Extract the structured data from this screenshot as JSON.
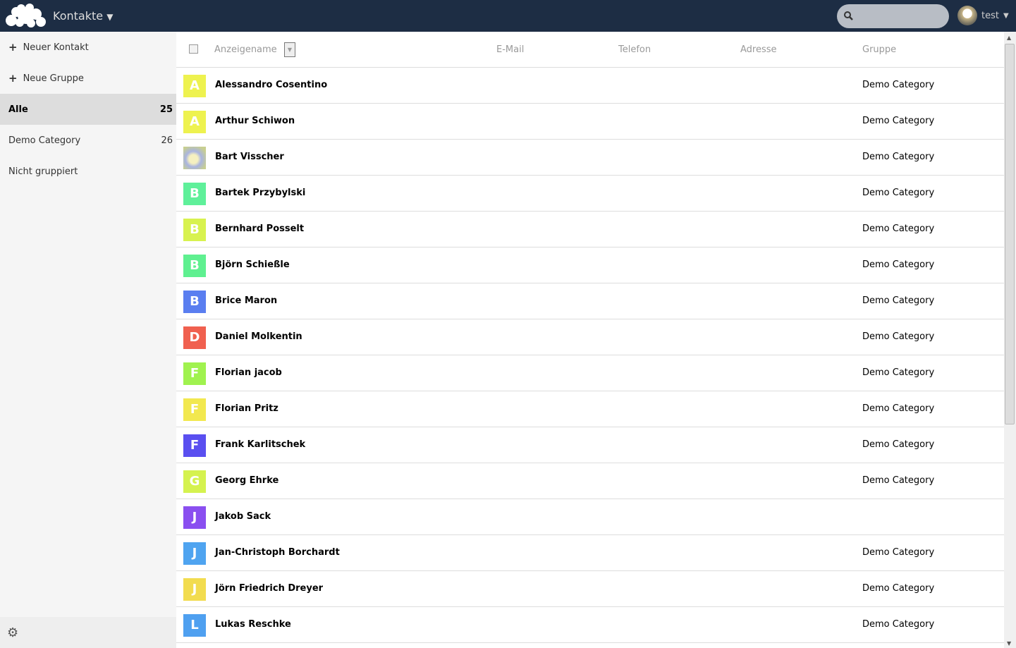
{
  "header": {
    "app_title": "Kontakte",
    "user": "test",
    "search_placeholder": ""
  },
  "sidebar": {
    "new_contact": "Neuer Kontakt",
    "new_group": "Neue Gruppe",
    "groups": [
      {
        "label": "Alle",
        "count": "25"
      },
      {
        "label": "Demo Category",
        "count": "26"
      },
      {
        "label": "Nicht gruppiert",
        "count": ""
      }
    ]
  },
  "table": {
    "columns": [
      "Anzeigename",
      "E-Mail",
      "Telefon",
      "Adresse",
      "Gruppe"
    ],
    "rows": [
      {
        "initial": "A",
        "color": "#eef24f",
        "name": "Alessandro Cosentino",
        "group": "Demo Category"
      },
      {
        "initial": "A",
        "color": "#eef24f",
        "name": "Arthur Schiwon",
        "group": "Demo Category"
      },
      {
        "initial": "",
        "color": "#c8cfa0",
        "name": "Bart Visscher",
        "group": "Demo Category",
        "photo": true
      },
      {
        "initial": "B",
        "color": "#5ff09a",
        "name": "Bartek Przybylski",
        "group": "Demo Category"
      },
      {
        "initial": "B",
        "color": "#d8f24f",
        "name": "Bernhard Posselt",
        "group": "Demo Category"
      },
      {
        "initial": "B",
        "color": "#5ff090",
        "name": "Björn Schießle",
        "group": "Demo Category"
      },
      {
        "initial": "B",
        "color": "#5a7ef0",
        "name": "Brice Maron",
        "group": "Demo Category"
      },
      {
        "initial": "D",
        "color": "#f0604f",
        "name": "Daniel Molkentin",
        "group": "Demo Category"
      },
      {
        "initial": "F",
        "color": "#a0f24f",
        "name": "Florian jacob",
        "group": "Demo Category"
      },
      {
        "initial": "F",
        "color": "#f2e84f",
        "name": "Florian Pritz",
        "group": "Demo Category"
      },
      {
        "initial": "F",
        "color": "#5a4ff0",
        "name": "Frank Karlitschek",
        "group": "Demo Category"
      },
      {
        "initial": "G",
        "color": "#d5f24f",
        "name": "Georg Ehrke",
        "group": "Demo Category"
      },
      {
        "initial": "J",
        "color": "#8a4ff0",
        "name": "Jakob Sack",
        "group": ""
      },
      {
        "initial": "J",
        "color": "#4fa4f0",
        "name": "Jan-Christoph Borchardt",
        "group": "Demo Category"
      },
      {
        "initial": "J",
        "color": "#f2dc4f",
        "name": "Jörn Friedrich Dreyer",
        "group": "Demo Category"
      },
      {
        "initial": "L",
        "color": "#4fa0f0",
        "name": "Lukas Reschke",
        "group": "Demo Category"
      }
    ]
  }
}
